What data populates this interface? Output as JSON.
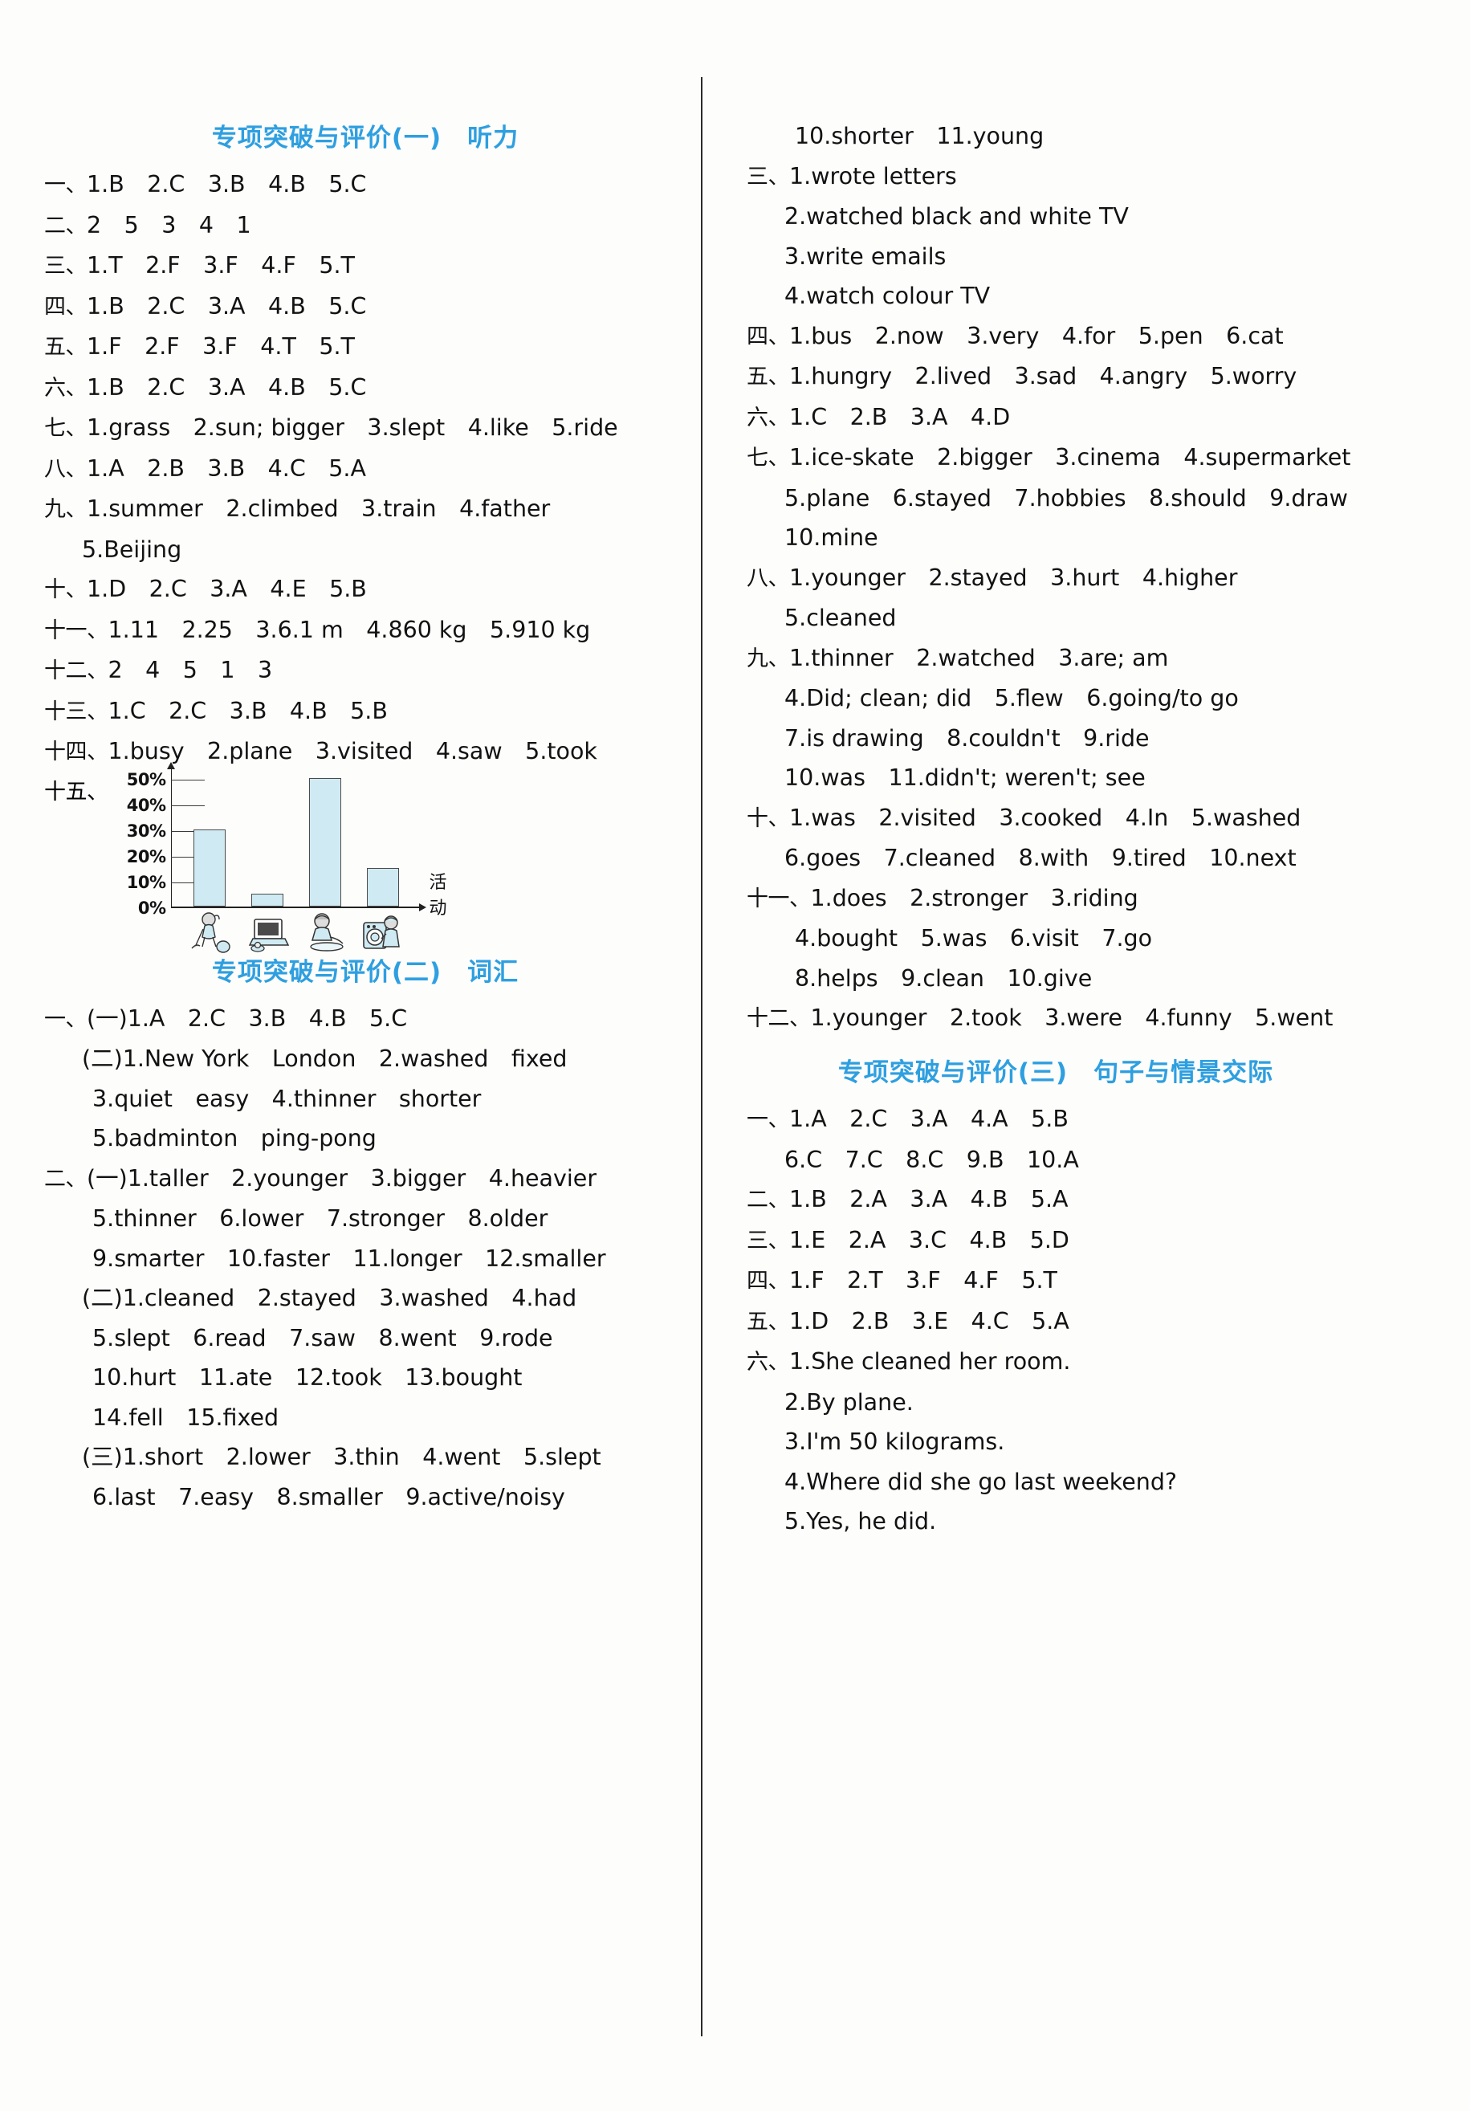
{
  "page": {
    "accent_color": "#2e9fe0",
    "text_color": "#121212",
    "bar_fill": "#cfeaf2"
  },
  "sections": [
    {
      "title": "专项突破与评价(一)　听力",
      "column": "left",
      "rows": [
        {
          "marker": "一、",
          "text": "1.B　2.C　3.B　4.B　5.C"
        },
        {
          "marker": "二、",
          "text": "2　5　3　4　1"
        },
        {
          "marker": "三、",
          "text": "1.T　2.F　3.F　4.F　5.T"
        },
        {
          "marker": "四、",
          "text": "1.B　2.C　3.A　4.B　5.C"
        },
        {
          "marker": "五、",
          "text": "1.F　2.F　3.F　4.T　5.T"
        },
        {
          "marker": "六、",
          "text": "1.B　2.C　3.A　4.B　5.C"
        },
        {
          "marker": "七、",
          "text": "1.grass　2.sun; bigger　3.slept　4.like　5.ride"
        },
        {
          "marker": "八、",
          "text": "1.A　2.B　3.B　4.C　5.A"
        },
        {
          "marker": "九、",
          "text": "1.summer　2.climbed　3.train　4.father"
        },
        {
          "marker": "",
          "text": "5.Beijing",
          "indent": "cont"
        },
        {
          "marker": "十、",
          "text": "1.D　2.C　3.A　4.E　5.B"
        },
        {
          "marker": "十一、",
          "text": "1.11　2.25　3.6.1 m　4.860 kg　5.910 kg"
        },
        {
          "marker": "十二、",
          "text": "2　4　5　1　3"
        },
        {
          "marker": "十三、",
          "text": "1.C　2.C　3.B　4.B　5.B"
        },
        {
          "marker": "十四、",
          "text": "1.busy　2.plane　3.visited　4.saw　5.took"
        },
        {
          "marker": "十五、",
          "text": "",
          "chart": true
        }
      ]
    },
    {
      "title": "专项突破与评价(二)　词汇",
      "column": "left",
      "rows": [
        {
          "marker": "一、",
          "text": "(一)1.A　2.C　3.B　4.B　5.C"
        },
        {
          "marker": "",
          "text": "(二)1.New York　London　2.washed　fixed",
          "indent": "cont"
        },
        {
          "marker": "",
          "text": "3.quiet　easy　4.thinner　shorter",
          "indent": "cont2"
        },
        {
          "marker": "",
          "text": "5.badminton　ping-pong",
          "indent": "cont2"
        },
        {
          "marker": "二、",
          "text": "(一)1.taller　2.younger　3.bigger　4.heavier"
        },
        {
          "marker": "",
          "text": "5.thinner　6.lower　7.stronger　8.older",
          "indent": "cont2"
        },
        {
          "marker": "",
          "text": "9.smarter　10.faster　11.longer　12.smaller",
          "indent": "cont2"
        },
        {
          "marker": "",
          "text": "(二)1.cleaned　2.stayed　3.washed　4.had",
          "indent": "cont"
        },
        {
          "marker": "",
          "text": "5.slept　6.read　7.saw　8.went　9.rode",
          "indent": "cont2"
        },
        {
          "marker": "",
          "text": "10.hurt　11.ate　12.took　13.bought",
          "indent": "cont2"
        },
        {
          "marker": "",
          "text": "14.fell　15.fixed",
          "indent": "cont2"
        },
        {
          "marker": "",
          "text": "(三)1.short　2.lower　3.thin　4.went　5.slept",
          "indent": "cont"
        },
        {
          "marker": "",
          "text": "6.last　7.easy　8.smaller　9.active/noisy",
          "indent": "cont2"
        }
      ]
    },
    {
      "title": "",
      "column": "right",
      "rows": [
        {
          "marker": "",
          "text": "10.shorter　11.young",
          "indent": "cont2"
        },
        {
          "marker": "三、",
          "text": "1.wrote letters"
        },
        {
          "marker": "",
          "text": "2.watched black and white TV",
          "indent": "cont"
        },
        {
          "marker": "",
          "text": "3.write emails",
          "indent": "cont"
        },
        {
          "marker": "",
          "text": "4.watch colour TV",
          "indent": "cont"
        },
        {
          "marker": "四、",
          "text": "1.bus　2.now　3.very　4.for　5.pen　6.cat"
        },
        {
          "marker": "五、",
          "text": "1.hungry　2.lived　3.sad　4.angry　5.worry"
        },
        {
          "marker": "六、",
          "text": "1.C　2.B　3.A　4.D"
        },
        {
          "marker": "七、",
          "text": "1.ice-skate　2.bigger　3.cinema　4.supermarket"
        },
        {
          "marker": "",
          "text": "5.plane　6.stayed　7.hobbies　8.should　9.draw",
          "indent": "cont"
        },
        {
          "marker": "",
          "text": "10.mine",
          "indent": "cont"
        },
        {
          "marker": "八、",
          "text": "1.younger　2.stayed　3.hurt　4.higher"
        },
        {
          "marker": "",
          "text": "5.cleaned",
          "indent": "cont"
        },
        {
          "marker": "九、",
          "text": "1.thinner　2.watched　3.are; am"
        },
        {
          "marker": "",
          "text": "4.Did; clean; did　5.flew　6.going/to go",
          "indent": "cont"
        },
        {
          "marker": "",
          "text": "7.is drawing　8.couldn't　9.ride",
          "indent": "cont"
        },
        {
          "marker": "",
          "text": "10.was　11.didn't; weren't; see",
          "indent": "cont"
        },
        {
          "marker": "十、",
          "text": "1.was　2.visited　3.cooked　4.In　5.washed"
        },
        {
          "marker": "",
          "text": "6.goes　7.cleaned　8.with　9.tired　10.next",
          "indent": "cont"
        },
        {
          "marker": "十一、",
          "text": "1.does　2.stronger　3.riding"
        },
        {
          "marker": "",
          "text": "4.bought　5.was　6.visit　7.go",
          "indent": "cont2"
        },
        {
          "marker": "",
          "text": "8.helps　9.clean　10.give",
          "indent": "cont2"
        },
        {
          "marker": "十二、",
          "text": "1.younger　2.took　3.were　4.funny　5.went"
        }
      ]
    },
    {
      "title": "专项突破与评价(三)　句子与情景交际",
      "column": "right",
      "rows": [
        {
          "marker": "一、",
          "text": "1.A　2.C　3.A　4.A　5.B"
        },
        {
          "marker": "",
          "text": "6.C　7.C　8.C　9.B　10.A",
          "indent": "cont"
        },
        {
          "marker": "二、",
          "text": "1.B　2.A　3.A　4.B　5.A"
        },
        {
          "marker": "三、",
          "text": "1.E　2.A　3.C　4.B　5.D"
        },
        {
          "marker": "四、",
          "text": "1.F　2.T　3.F　4.F　5.T"
        },
        {
          "marker": "五、",
          "text": "1.D　2.B　3.E　4.C　5.A"
        },
        {
          "marker": "六、",
          "text": "1.She cleaned her room."
        },
        {
          "marker": "",
          "text": "2.By plane.",
          "indent": "cont"
        },
        {
          "marker": "",
          "text": "3.I'm 50 kilograms.",
          "indent": "cont"
        },
        {
          "marker": "",
          "text": "4.Where did she go last weekend?",
          "indent": "cont"
        },
        {
          "marker": "",
          "text": "5.Yes, he did.",
          "indent": "cont"
        }
      ]
    }
  ],
  "chart_data": {
    "type": "bar",
    "title": "",
    "xlabel": "活动",
    "ylabel": "",
    "ylim": [
      0,
      50
    ],
    "grid": false,
    "legend": "none",
    "categories": [
      "clean-the-room",
      "watch-TV",
      "read-and-write",
      "wash-clothes"
    ],
    "category_icons": [
      "cleaning-girl-icon",
      "television-icon",
      "boy-reading-icon",
      "washing-machine-icon"
    ],
    "values": [
      30,
      5,
      50,
      15
    ],
    "tick_labels": [
      "0%",
      "10%",
      "20%",
      "30%",
      "40%",
      "50%"
    ],
    "tick_values": [
      0,
      10,
      20,
      30,
      40,
      50
    ]
  }
}
